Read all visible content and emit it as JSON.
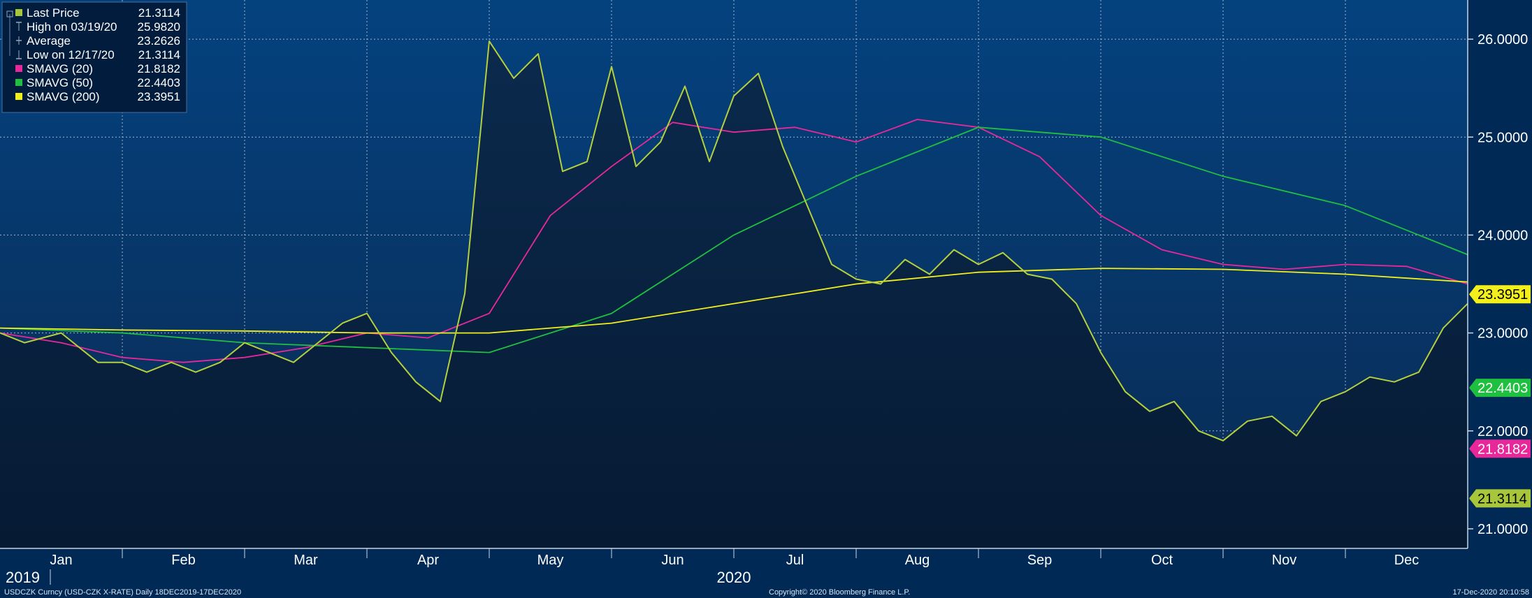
{
  "chart_data": {
    "type": "line",
    "x_axis": {
      "months": [
        "Jan",
        "Feb",
        "Mar",
        "Apr",
        "May",
        "Jun",
        "Jul",
        "Aug",
        "Sep",
        "Oct",
        "Nov",
        "Dec"
      ],
      "years": [
        "2019",
        "2020"
      ]
    },
    "y_axis": {
      "ylim": [
        20.8,
        26.4
      ],
      "ticks": [
        "21.0000",
        "22.0000",
        "23.0000",
        "24.0000",
        "25.0000",
        "26.0000"
      ],
      "position": "right"
    },
    "legend": {
      "placement": "top-left",
      "items": [
        {
          "label": "Last Price",
          "value": "21.3114",
          "marker": "square",
          "color": "#a8c63a"
        },
        {
          "label": "High on 03/19/20",
          "value": "25.9820",
          "marker": "high-icon",
          "color": "#9aa8b8"
        },
        {
          "label": "Average",
          "value": "23.2626",
          "marker": "average-icon",
          "color": "#9aa8b8"
        },
        {
          "label": "Low on 12/17/20",
          "value": "21.3114",
          "marker": "low-icon",
          "color": "#9aa8b8"
        },
        {
          "label": "SMAVG (20)",
          "value": "21.8182",
          "marker": "square",
          "color": "#e8289a"
        },
        {
          "label": "SMAVG (50)",
          "value": "22.4403",
          "marker": "square",
          "color": "#1fbf3f"
        },
        {
          "label": "SMAVG (200)",
          "value": "23.3951",
          "marker": "square",
          "color": "#f2ef1c"
        }
      ]
    },
    "series": [
      {
        "name": "Last Price",
        "color": "#b5cf3d",
        "filled": true,
        "t": [
          0,
          0.2,
          0.5,
          0.8,
          1.0,
          1.2,
          1.4,
          1.6,
          1.8,
          2.0,
          2.2,
          2.4,
          2.6,
          2.8,
          3.0,
          3.2,
          3.4,
          3.6,
          3.8,
          4.0,
          4.2,
          4.4,
          4.6,
          4.8,
          5.0,
          5.2,
          5.4,
          5.6,
          5.8,
          6.0,
          6.2,
          6.4,
          6.6,
          6.8,
          7.0,
          7.2,
          7.4,
          7.6,
          7.8,
          8.0,
          8.2,
          8.4,
          8.6,
          8.8,
          9.0,
          9.2,
          9.4,
          9.6,
          9.8,
          10.0,
          10.2,
          10.4,
          10.6,
          10.8,
          11.0,
          11.2,
          11.4,
          11.6,
          11.8,
          12.0
        ],
        "y": [
          23.0,
          22.9,
          23.0,
          22.7,
          22.7,
          22.6,
          22.7,
          22.6,
          22.7,
          22.9,
          22.8,
          22.7,
          22.9,
          23.1,
          23.2,
          22.8,
          22.5,
          22.3,
          23.4,
          25.98,
          25.6,
          25.85,
          24.65,
          24.75,
          25.72,
          24.7,
          24.95,
          25.52,
          24.75,
          25.42,
          25.65,
          24.9,
          24.3,
          23.7,
          23.55,
          23.5,
          23.75,
          23.6,
          23.85,
          23.7,
          23.82,
          23.6,
          23.55,
          23.3,
          22.8,
          22.4,
          22.2,
          22.3,
          22.0,
          21.9,
          22.1,
          22.15,
          21.95,
          22.3,
          22.4,
          22.55,
          22.5,
          22.6,
          23.05,
          23.3
        ]
      },
      {
        "name": "SMAVG (20)",
        "color": "#e8289a",
        "t": [
          0,
          0.5,
          1.0,
          1.5,
          2.0,
          2.5,
          3.0,
          3.5,
          4.0,
          4.5,
          5.0,
          5.5,
          6.0,
          6.5,
          7.0,
          7.5,
          8.0,
          8.5,
          9.0,
          9.5,
          10.0,
          10.5,
          11.0,
          11.5,
          12.0
        ],
        "y": [
          23.0,
          22.9,
          22.75,
          22.7,
          22.75,
          22.85,
          23.0,
          22.95,
          23.2,
          24.2,
          24.7,
          25.15,
          25.05,
          25.1,
          24.95,
          25.18,
          25.1,
          24.8,
          24.2,
          23.85,
          23.7,
          23.65,
          23.7,
          23.68,
          23.5
        ]
      },
      {
        "name": "SMAVG (50)",
        "color": "#1fbf3f",
        "t": [
          0,
          1,
          2,
          3,
          4,
          5,
          6,
          7,
          8,
          9,
          10,
          11,
          12
        ],
        "y": [
          23.05,
          23.0,
          22.9,
          22.85,
          22.8,
          23.2,
          24.0,
          24.6,
          25.1,
          25.0,
          24.6,
          24.3,
          23.8
        ]
      },
      {
        "name": "SMAVG (200)",
        "color": "#f2ef1c",
        "t": [
          0,
          1,
          2,
          3,
          4,
          5,
          6,
          7,
          8,
          9,
          10,
          11,
          12
        ],
        "y": [
          23.05,
          23.03,
          23.02,
          23.0,
          23.0,
          23.1,
          23.3,
          23.5,
          23.62,
          23.66,
          23.65,
          23.6,
          23.52
        ]
      }
    ],
    "last_value_tags": [
      {
        "value": "23.3951",
        "color": "#f2ef1c",
        "text_color": "#000000"
      },
      {
        "value": "22.4403",
        "color": "#1fbf3f",
        "text_color": "#ffffff"
      },
      {
        "value": "21.8182",
        "color": "#e8289a",
        "text_color": "#ffffff"
      },
      {
        "value": "21.3114",
        "color": "#a8c63a",
        "text_color": "#000000"
      }
    ]
  },
  "footer": {
    "ticker": "USDCZK Curncy (USD-CZK X-RATE)  Daily 18DEC2019-17DEC2020",
    "copyright": "Copyright© 2020 Bloomberg Finance L.P.",
    "timestamp": "17-Dec-2020 20:10:58"
  }
}
